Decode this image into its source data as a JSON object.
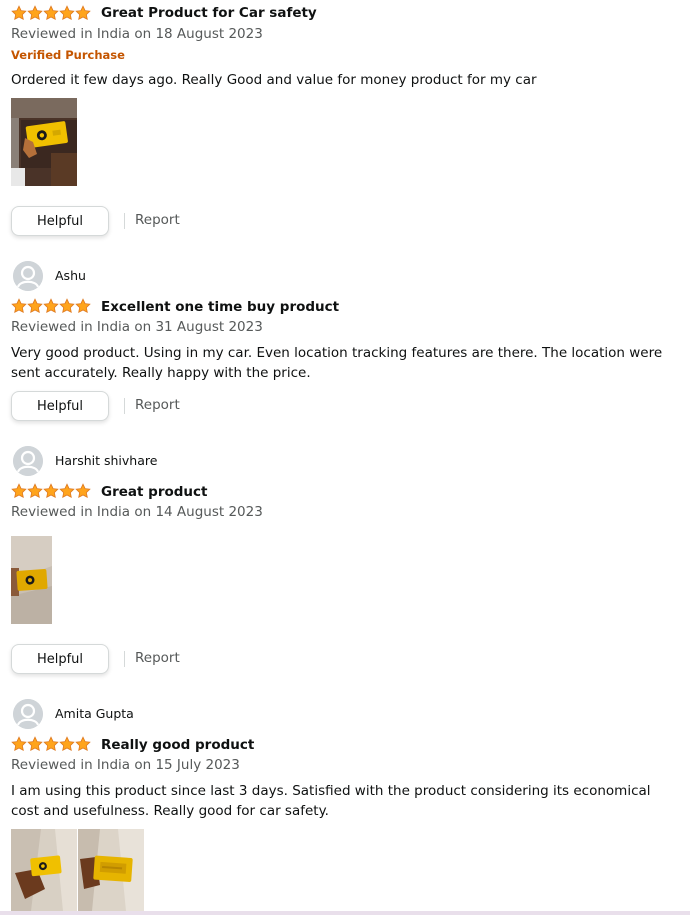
{
  "reviews": [
    {
      "rating": 5,
      "title": "Great Product for Car safety",
      "meta": "Reviewed in India on 18 August 2023",
      "verified": "Verified Purchase",
      "body": "Ordered it few days ago. Really Good and value for money product for my car",
      "helpful_label": "Helpful",
      "report_label": "Report"
    },
    {
      "reviewer": "Ashu",
      "rating": 5,
      "title": "Excellent one time buy product",
      "meta": "Reviewed in India on 31 August 2023",
      "body": "Very good product. Using in my car. Even location tracking features are there. The location were sent accurately. Really happy with the price.",
      "helpful_label": "Helpful",
      "report_label": "Report"
    },
    {
      "reviewer": "Harshit shivhare",
      "rating": 5,
      "title": "Great product",
      "meta": "Reviewed in India on 14 August 2023",
      "helpful_label": "Helpful",
      "report_label": "Report"
    },
    {
      "reviewer": "Amita Gupta",
      "rating": 5,
      "title": "Really good product",
      "meta": "Reviewed in India on 15 July 2023",
      "body": "I am using this product since last 3 days. Satisfied with the product considering its economical cost and usefulness. Really good for car safety."
    }
  ],
  "colors": {
    "star": "#ffa41c",
    "star_edge": "#de7921",
    "verified": "#c45500",
    "meta": "#565959"
  },
  "icons": {
    "rating": "star-icon",
    "avatar": "default-user-avatar-icon"
  }
}
